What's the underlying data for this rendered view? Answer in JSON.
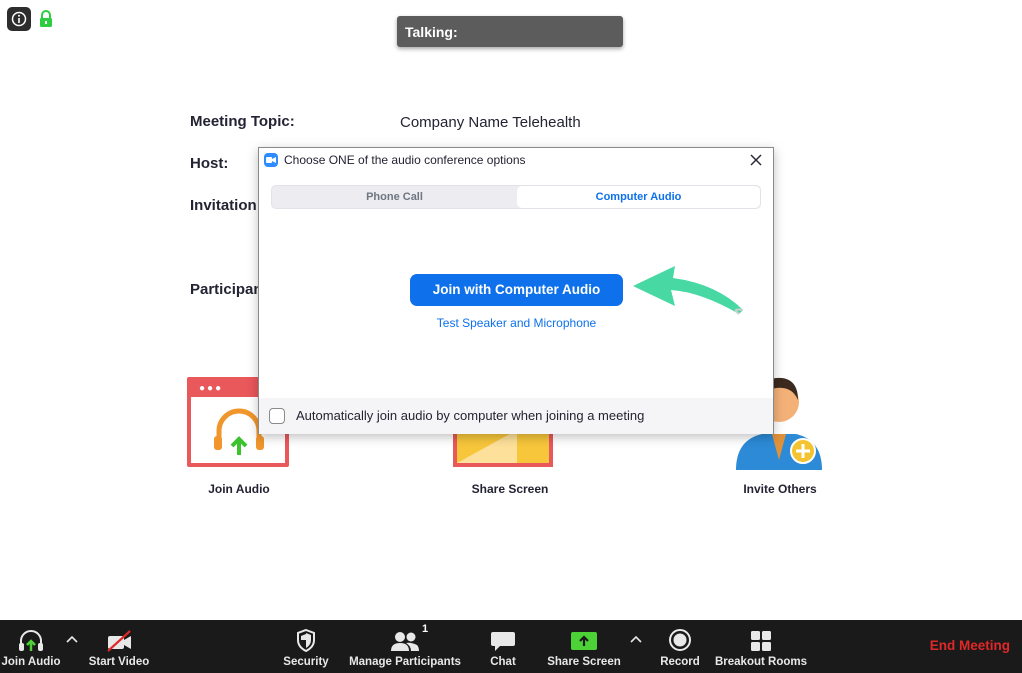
{
  "status": {
    "talking_label": "Talking:"
  },
  "meeting": {
    "topic_label": "Meeting Topic:",
    "topic_value": "Company Name Telehealth",
    "host_label": "Host:",
    "invitation_label": "Invitation",
    "participants_label": "Participan"
  },
  "tiles": {
    "join_audio": "Join Audio",
    "share_screen": "Share Screen",
    "invite_others": "Invite Others"
  },
  "dialog": {
    "title": "Choose ONE of the audio conference options",
    "tabs": [
      {
        "label": "Phone Call",
        "selected": false
      },
      {
        "label": "Computer Audio",
        "selected": true
      }
    ],
    "join_button": "Join with Computer Audio",
    "test_link": "Test Speaker and Microphone",
    "auto_join_label": "Automatically join audio by computer when joining a meeting",
    "auto_join_checked": false
  },
  "toolbar": {
    "join_audio": "Join Audio",
    "start_video": "Start Video",
    "security": "Security",
    "manage_participants": "Manage Participants",
    "participant_count": "1",
    "chat": "Chat",
    "share_screen": "Share Screen",
    "record": "Record",
    "breakout_rooms": "Breakout Rooms",
    "end_meeting": "End Meeting"
  },
  "colors": {
    "accent_blue": "#0e71eb",
    "arrow_green": "#48d8a4",
    "end_red": "#e02828",
    "share_green": "#4cd137",
    "tile_red": "#e9585b"
  }
}
